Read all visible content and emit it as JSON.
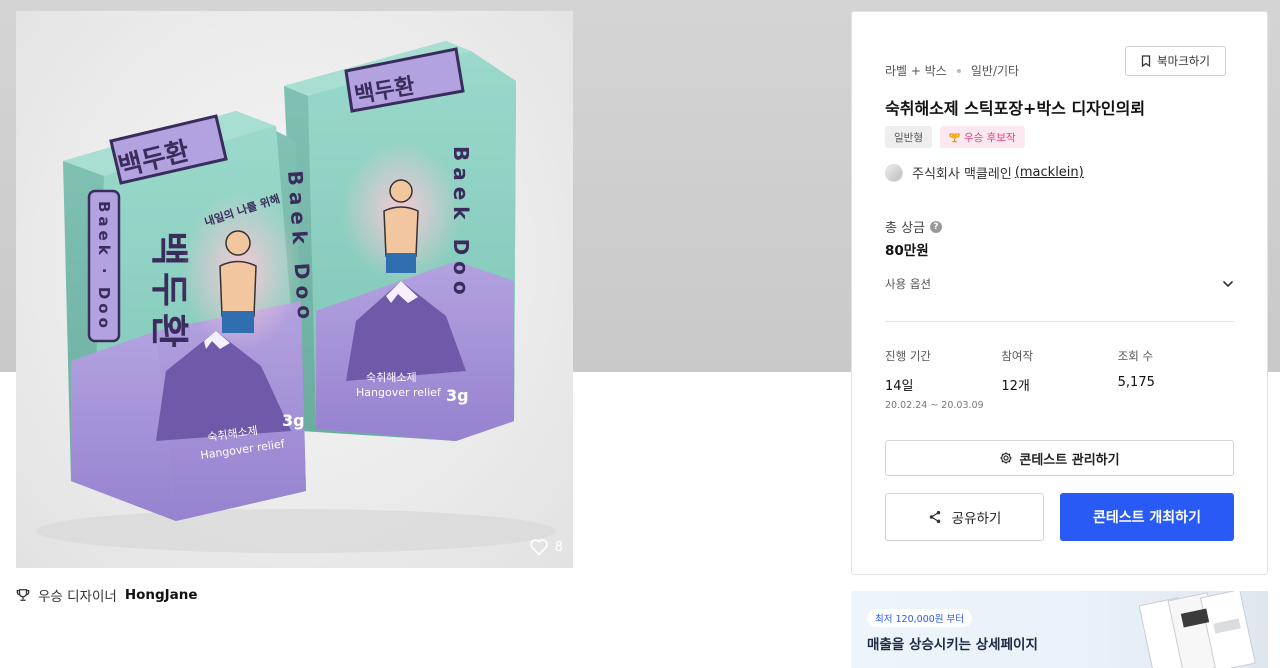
{
  "image": {
    "box_front": {
      "brand_en": "Baek Doo",
      "brand_en_dotted": "Baek · Doo",
      "title_ko": "백두환",
      "tagline": "내일의 나를 위해",
      "product_ko": "숙취해소제",
      "product_en": "Hangover relief",
      "weight": "3g"
    },
    "like_count": "8",
    "like_icon": "heart-outline-icon"
  },
  "designer": {
    "icon": "trophy-icon",
    "label": "우승 디자이너",
    "name": "HongJane"
  },
  "panel": {
    "category_main": "라벨 + 박스",
    "category_sub": "일반/기타",
    "bookmark_label": "북마크하기",
    "title": "숙취해소제 스틱포장+박스 디자인의뢰",
    "badge_type": "일반형",
    "badge_award": "우승 후보작",
    "host_name": "주식회사 맥클레인",
    "host_id": "(macklein)",
    "prize_label": "총 상금",
    "prize_value": "80만원",
    "options_label": "사용 옵션",
    "stats": [
      {
        "label": "진행 기간",
        "value": "14일",
        "sub": "20.02.24 ~ 20.03.09"
      },
      {
        "label": "참여작",
        "value": "12개",
        "sub": ""
      },
      {
        "label": "조회 수",
        "value": "5,175",
        "sub": ""
      }
    ],
    "manage_label": "콘테스트 관리하기",
    "share_label": "공유하기",
    "host_contest_label": "콘테스트 개최하기"
  },
  "ad": {
    "tag": "최저 120,000원 부터",
    "text": "매출을 상승시키는 상세페이지"
  },
  "colors": {
    "primary": "#2a5af6",
    "box_mint": "#8fd1c3",
    "box_lavender": "#a28fd1",
    "award_pink": "#e0437d"
  }
}
